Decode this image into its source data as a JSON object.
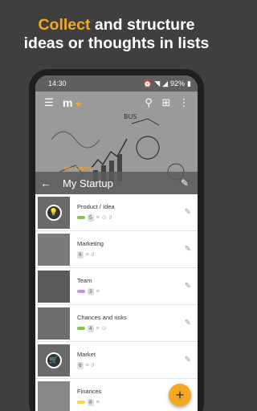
{
  "promo": {
    "highlight": "Collect",
    "rest_line1": " and structure",
    "line2": "ideas or thoughts in lists"
  },
  "statusbar": {
    "time": "14:30",
    "battery": "92%"
  },
  "app": {
    "logo": "m",
    "breadcrumb": "My Startup",
    "title": "My Startup"
  },
  "items": [
    {
      "name": "Product / Idea",
      "count": "5",
      "pill_color": "#8bc34a"
    },
    {
      "name": "Marketing",
      "count": "6",
      "pill_color": ""
    },
    {
      "name": "Team",
      "count": "3",
      "pill_color": "#ce93d8"
    },
    {
      "name": "Chances and risks",
      "count": "4",
      "pill_color": "#8bc34a"
    },
    {
      "name": "Market",
      "count": "6",
      "pill_color": ""
    },
    {
      "name": "Finances",
      "count": "8",
      "pill_color": "#ffd54f"
    }
  ],
  "colors": {
    "accent": "#f5a623",
    "background": "#3f3f3f"
  },
  "icons": [
    "menu-icon",
    "star-icon",
    "search-icon",
    "hierarchy-icon",
    "more-icon",
    "back-icon",
    "edit-icon",
    "list-icon",
    "link-icon",
    "attachment-icon",
    "add-icon",
    "lightbulb-icon",
    "cart-icon"
  ]
}
